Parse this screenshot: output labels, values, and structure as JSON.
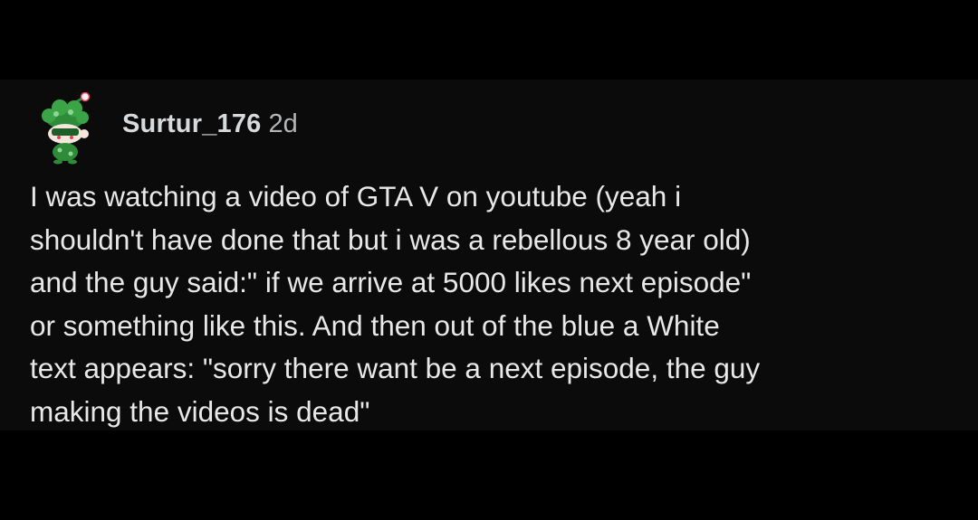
{
  "comment": {
    "author": "Surtur_176",
    "age": "2d",
    "avatar_icon": "snoo-avatar-icon",
    "body_lines": [
      "I was watching a video of GTA V on youtube (yeah i",
      "shouldn't have done that but i was a rebellous 8 year old)",
      "and the guy said:\" if we arrive at 5000 likes next episode\"",
      "or something like this. And then out of the blue a White",
      "text appears: \"sorry there want be a next episode, the guy",
      "making the videos is dead\""
    ]
  },
  "colors": {
    "background": "#000000",
    "comment_background": "#0b0b0b",
    "text": "#e8e8e8",
    "avatar_green": "#2e8b3a",
    "avatar_accent": "#e0405a"
  }
}
